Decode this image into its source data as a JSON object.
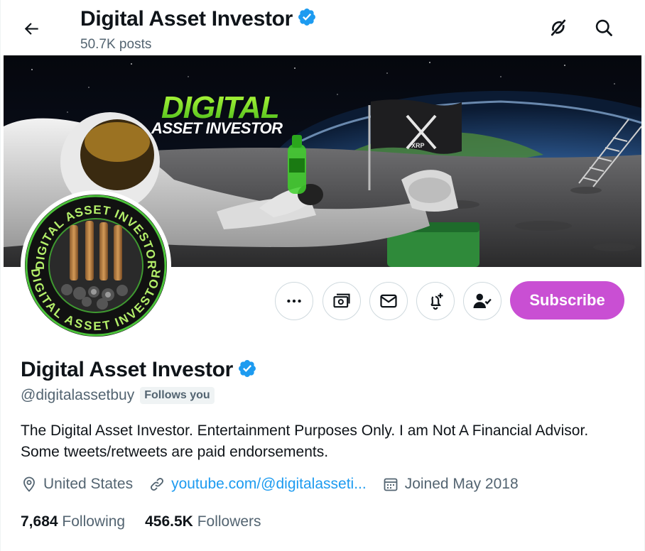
{
  "header": {
    "title": "Digital Asset Investor",
    "posts_count": "50.7K posts"
  },
  "banner": {
    "logo_line1": "DIGITAL",
    "logo_line2": "ASSET INVESTOR",
    "flag_text": "XRP"
  },
  "avatar": {
    "ring_text_top": "DIGITAL ASSET INVESTOR",
    "ring_text_bottom": "DIGITAL ASSET INVESTOR"
  },
  "actions": {
    "subscribe_label": "Subscribe",
    "icons": [
      "more-icon",
      "tip-money-icon",
      "message-icon",
      "notify-bell-icon",
      "following-person-icon"
    ]
  },
  "profile": {
    "name": "Digital Asset Investor",
    "handle": "@digitalassetbuy",
    "follows_you": "Follows you",
    "bio": "The Digital Asset Investor. Entertainment Purposes Only. I am Not A Financial Advisor. Some tweets/retweets are paid endorsements.",
    "location": "United States",
    "website": "youtube.com/@digitalasseti...",
    "joined": "Joined May 2018"
  },
  "stats": {
    "following_count": "7,684",
    "following_label": "Following",
    "followers_count": "456.5K",
    "followers_label": "Followers"
  },
  "colors": {
    "verified_badge": "#1d9bf0",
    "subscribe_bg": "#c94fd3",
    "link": "#1d9bf0",
    "secondary_text": "#536471"
  }
}
